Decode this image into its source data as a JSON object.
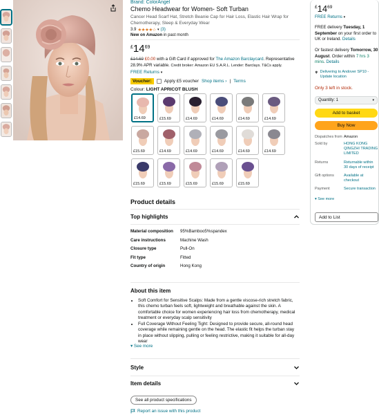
{
  "product": {
    "brand": "Brand: ColorAngel",
    "title": "Chemo Headwear for Women- Soft Turban",
    "subtitle": "Cancer Head Scarf Hat, Stretch Beanie Cap for Hair Loss, Elastic Hair Wrap for Chemotherapy, Sleep & Everyday Wear",
    "rating_value": "3.9",
    "rating_count": "(3)",
    "new_on_prefix": "New on Amazon",
    "new_on_suffix": "in past month"
  },
  "price": {
    "symbol": "£",
    "whole": "14",
    "fraction": "69",
    "strike": "£14.69",
    "discount": "£0.00",
    "offer_text": "with a Gift Card if approved for",
    "offer_link": "The Amazon Barclaycard",
    "offer_text2": ". Representative 28.9% APR variable.",
    "offer_small": "Credit broker: Amazon EU S.A.R.L. Lender: Barclays. T&Cs apply.",
    "free_returns": "FREE Returns"
  },
  "voucher": {
    "badge": "Voucher:",
    "apply_text": "Apply £5 voucher",
    "shop_items": "Shop items ›",
    "sep": "|",
    "terms": "Terms"
  },
  "colour": {
    "label": "Colour:",
    "selected": "LIGHT APRICOT BLUSH"
  },
  "swatches": [
    {
      "price": "£14.69",
      "color": "#e8b8ae"
    },
    {
      "price": "£15.69",
      "color": "#5b3a6e"
    },
    {
      "price": "£14.69",
      "color": "#2a2030"
    },
    {
      "price": "£14.69",
      "color": "#4a4d7a"
    },
    {
      "price": "£14.69",
      "color": "#7a7a7a"
    },
    {
      "price": "£14.69",
      "color": "#6a5a80"
    },
    {
      "price": "£15.69",
      "color": "#c9a8a0"
    },
    {
      "price": "£14.69",
      "color": "#a0606a"
    },
    {
      "price": "£14.69",
      "color": "#b0b0b8"
    },
    {
      "price": "£14.69",
      "color": "#9a9aa0"
    },
    {
      "price": "£14.69",
      "color": "#e0dcd8"
    },
    {
      "price": "£14.69",
      "color": "#8a8890"
    },
    {
      "price": "£15.69",
      "color": "#3a3a6a"
    },
    {
      "price": "£15.69",
      "color": "#8a6aa8"
    },
    {
      "price": "£15.69",
      "color": "#c08a98"
    },
    {
      "price": "£15.69",
      "color": "#b0a0b8"
    },
    {
      "price": "£15.69",
      "color": "#6a5090"
    }
  ],
  "details": {
    "heading": "Product details",
    "top_highlights": "Top highlights",
    "rows": [
      {
        "k": "Material composition",
        "v": "95%Bamboo5%spandex"
      },
      {
        "k": "Care instructions",
        "v": "Machine Wash"
      },
      {
        "k": "Closure type",
        "v": "Pull-On"
      },
      {
        "k": "Fit type",
        "v": "Fitted"
      },
      {
        "k": "Country of origin",
        "v": "Hong Kong"
      }
    ]
  },
  "about": {
    "heading": "About this item",
    "bullets": [
      "Soft Comfort for Sensitive Scalps: Made from a gentle viscose-rich stretch fabric, this chemo turban feels soft, lightweight and breathable against the skin. A comfortable choice for women experiencing hair loss from chemotherapy, medical treatment or everyday scalp sensitivity",
      "Full Coverage Without Feeling Tight: Designed to provide secure, all-round head coverage while remaining gentle on the head. The elastic fit helps the turban stay in place without slipping, pulling or feeling restrictive, making it suitable for all-day wear"
    ],
    "see_more": "See more"
  },
  "sections": {
    "style": "Style",
    "item_details": "Item details",
    "see_all_specs": "See all product specifications",
    "report": "Report an issue with this product"
  },
  "buybox": {
    "symbol": "£",
    "whole": "14",
    "fraction": "69",
    "free_returns": "FREE Returns",
    "delivery1": "FREE delivery",
    "delivery1_date": "Tuesday, 1 September",
    "delivery1_rest": "on your first order to UK or Ireland.",
    "details": "Details",
    "fastest_prefix": "Or fastest delivery",
    "fastest_date": "Tomorrow, 30 August",
    "fastest_mid": ". Order within",
    "fastest_time": "7 hrs 3 mins",
    "location": "Delivering to Andover SP10 - Update location",
    "stock": "Only 3 left in stock.",
    "quantity": "Quantity: 1",
    "add_to_basket": "Add to basket",
    "buy_now": "Buy Now",
    "info": [
      {
        "k": "Dispatches from",
        "v": "Amazon"
      },
      {
        "k": "Sold by",
        "v": "HONG KONG QINGZHI TRADING LIMITED"
      },
      {
        "k": "Returns",
        "v": "Returnable within 30 days of receipt"
      },
      {
        "k": "Gift options",
        "v": "Available at checkout"
      },
      {
        "k": "Payment",
        "v": "Secure transaction"
      }
    ],
    "see_more": "See more",
    "add_to_list": "Add to List"
  }
}
